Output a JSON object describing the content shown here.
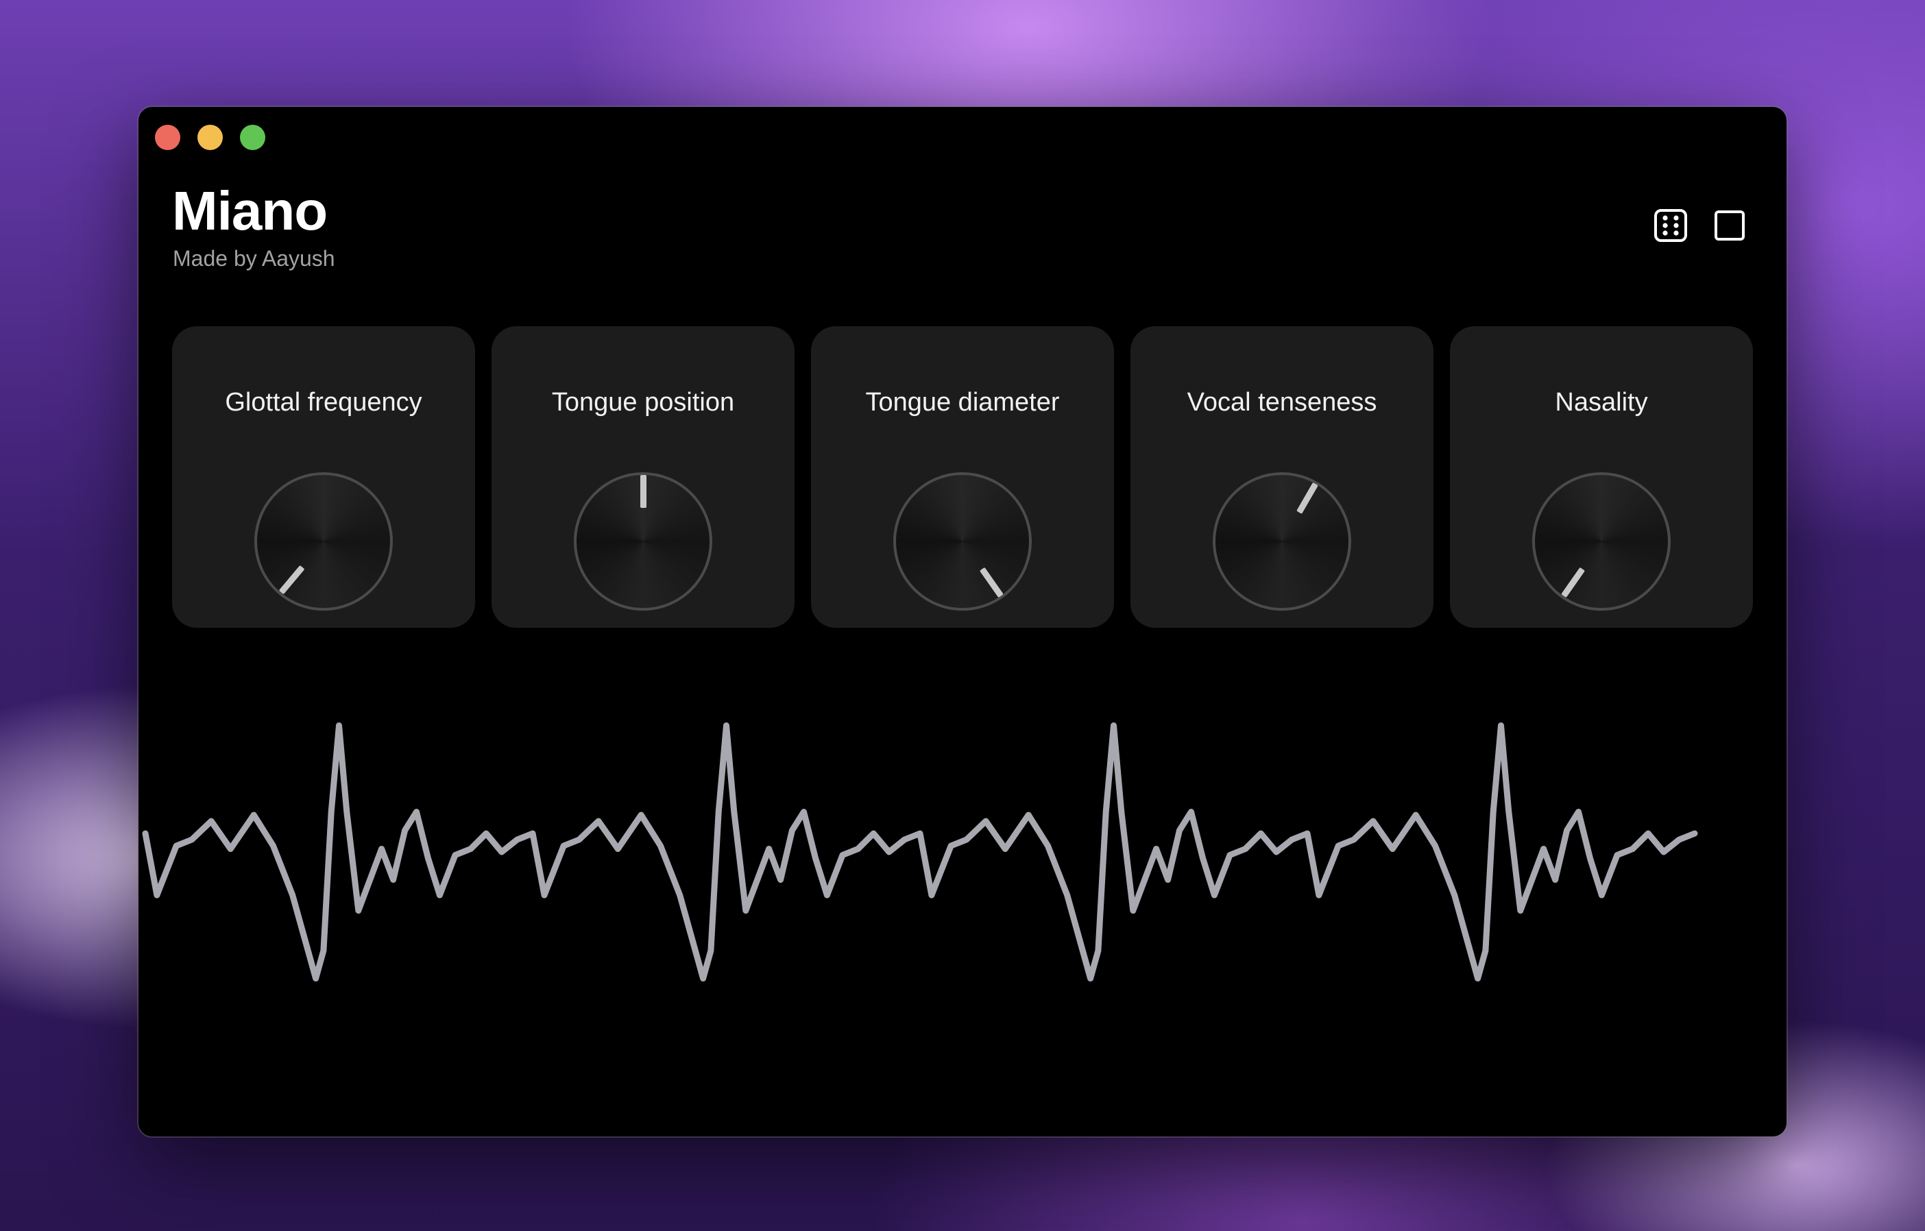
{
  "window": {
    "traffic_lights": [
      {
        "name": "close",
        "color": "#ed6a5e"
      },
      {
        "name": "minimize",
        "color": "#f5bf4f"
      },
      {
        "name": "zoom",
        "color": "#61c554"
      }
    ]
  },
  "header": {
    "title": "Miano",
    "subtitle": "Made by Aayush"
  },
  "toolbar": {
    "randomize_icon": "dice-icon",
    "stop_icon": "square-icon"
  },
  "controls": [
    {
      "label": "Glottal frequency",
      "value_angle_deg": -140
    },
    {
      "label": "Tongue position",
      "value_angle_deg": 0
    },
    {
      "label": "Tongue diameter",
      "value_angle_deg": 145
    },
    {
      "label": "Vocal tenseness",
      "value_angle_deg": 30
    },
    {
      "label": "Nasality",
      "value_angle_deg": -145
    }
  ],
  "colors": {
    "background": "#000000",
    "card": "#1c1c1c",
    "waveform": "#a8a8b0",
    "text_primary": "#ffffff",
    "text_secondary": "#a3a3a3"
  }
}
